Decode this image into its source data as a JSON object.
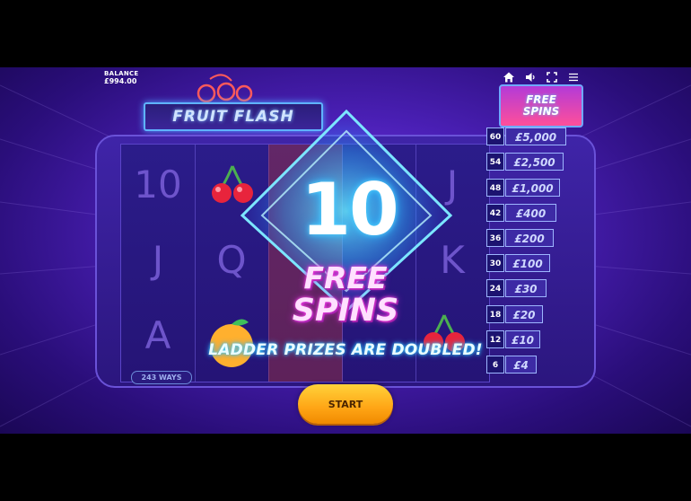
{
  "balance": {
    "label": "BALANCE",
    "value": "£994.00"
  },
  "toolbar": {
    "icons": [
      "home-icon",
      "speaker-icon",
      "fullscreen-icon",
      "menu-icon"
    ]
  },
  "game": {
    "title": "FRUIT FLASH",
    "ways": "243 WAYS"
  },
  "reels": {
    "symbols": [
      [
        "10",
        "J",
        "A"
      ],
      [
        "cherry",
        "Q",
        "orange"
      ],
      [
        "",
        "",
        ""
      ],
      [
        "",
        "",
        ""
      ],
      [
        "J",
        "K",
        "cherry"
      ]
    ]
  },
  "ladder": {
    "header_line1": "FREE",
    "header_line2": "SPINS",
    "rungs": [
      {
        "spins": "60",
        "prize": "£5,000"
      },
      {
        "spins": "54",
        "prize": "£2,500"
      },
      {
        "spins": "48",
        "prize": "£1,000"
      },
      {
        "spins": "42",
        "prize": "£400"
      },
      {
        "spins": "36",
        "prize": "£200"
      },
      {
        "spins": "30",
        "prize": "£100"
      },
      {
        "spins": "24",
        "prize": "£30"
      },
      {
        "spins": "18",
        "prize": "£20"
      },
      {
        "spins": "12",
        "prize": "£10"
      },
      {
        "spins": "6",
        "prize": "£4"
      }
    ]
  },
  "overlay": {
    "count": "10",
    "line1": "FREE",
    "line2": "SPINS",
    "message": "LADDER PRIZES ARE DOUBLED!"
  },
  "start_button": {
    "label": "START"
  },
  "colors": {
    "accent": "#ffa515",
    "background": "#4a1fb5",
    "glow": "#54d6ff",
    "pink": "#ff4fe8"
  }
}
